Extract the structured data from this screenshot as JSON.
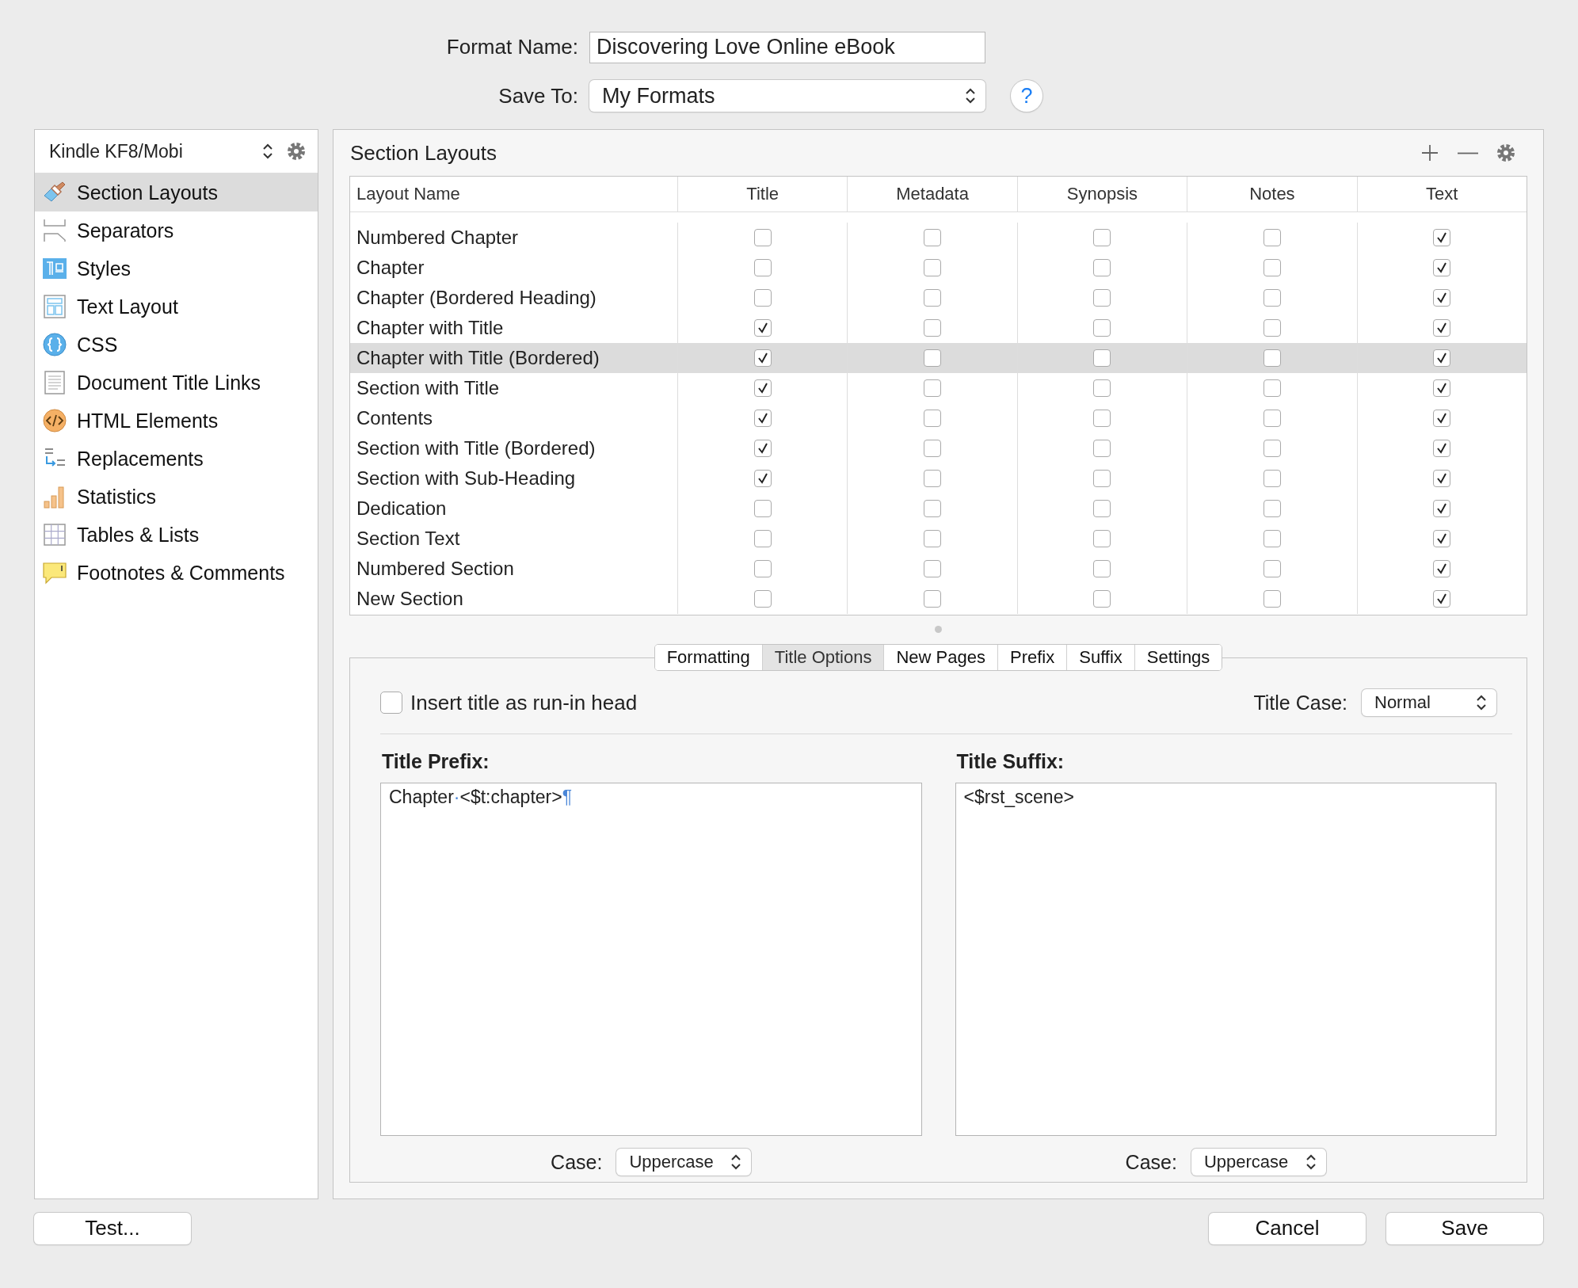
{
  "format_name": {
    "label": "Format Name:",
    "value": "Discovering Love Online eBook"
  },
  "save_to": {
    "label": "Save To:",
    "value": "My Formats"
  },
  "help_button": {
    "label": "?"
  },
  "sidebar": {
    "format_popup": "Kindle KF8/Mobi",
    "items": [
      {
        "label": "Section Layouts",
        "selected": true
      },
      {
        "label": "Separators",
        "selected": false
      },
      {
        "label": "Styles",
        "selected": false
      },
      {
        "label": "Text Layout",
        "selected": false
      },
      {
        "label": "CSS",
        "selected": false
      },
      {
        "label": "Document Title Links",
        "selected": false
      },
      {
        "label": "HTML Elements",
        "selected": false
      },
      {
        "label": "Replacements",
        "selected": false
      },
      {
        "label": "Statistics",
        "selected": false
      },
      {
        "label": "Tables & Lists",
        "selected": false
      },
      {
        "label": "Footnotes & Comments",
        "selected": false
      }
    ]
  },
  "section_layouts": {
    "title": "Section Layouts",
    "columns": [
      "Layout Name",
      "Title",
      "Metadata",
      "Synopsis",
      "Notes",
      "Text"
    ],
    "rows": [
      {
        "name": "Numbered Chapter",
        "checks": [
          false,
          false,
          false,
          false,
          true
        ],
        "selected": false
      },
      {
        "name": "Chapter",
        "checks": [
          false,
          false,
          false,
          false,
          true
        ],
        "selected": false
      },
      {
        "name": "Chapter (Bordered Heading)",
        "checks": [
          false,
          false,
          false,
          false,
          true
        ],
        "selected": false
      },
      {
        "name": "Chapter with Title",
        "checks": [
          true,
          false,
          false,
          false,
          true
        ],
        "selected": false
      },
      {
        "name": "Chapter with Title (Bordered)",
        "checks": [
          true,
          false,
          false,
          false,
          true
        ],
        "selected": true
      },
      {
        "name": "Section with Title",
        "checks": [
          true,
          false,
          false,
          false,
          true
        ],
        "selected": false
      },
      {
        "name": "Contents",
        "checks": [
          true,
          false,
          false,
          false,
          true
        ],
        "selected": false
      },
      {
        "name": "Section with Title (Bordered)",
        "checks": [
          true,
          false,
          false,
          false,
          true
        ],
        "selected": false
      },
      {
        "name": "Section with Sub-Heading",
        "checks": [
          true,
          false,
          false,
          false,
          true
        ],
        "selected": false
      },
      {
        "name": "Dedication",
        "checks": [
          false,
          false,
          false,
          false,
          true
        ],
        "selected": false
      },
      {
        "name": "Section Text",
        "checks": [
          false,
          false,
          false,
          false,
          true
        ],
        "selected": false
      },
      {
        "name": "Numbered Section",
        "checks": [
          false,
          false,
          false,
          false,
          true
        ],
        "selected": false
      },
      {
        "name": "New Section",
        "checks": [
          false,
          false,
          false,
          false,
          true
        ],
        "selected": false
      }
    ]
  },
  "tabs": [
    {
      "label": "Formatting",
      "selected": false
    },
    {
      "label": "Title Options",
      "selected": true
    },
    {
      "label": "New Pages",
      "selected": false
    },
    {
      "label": "Prefix",
      "selected": false
    },
    {
      "label": "Suffix",
      "selected": false
    },
    {
      "label": "Settings",
      "selected": false
    }
  ],
  "title_options": {
    "run_in_head": {
      "label": "Insert title as run-in head",
      "checked": false
    },
    "title_case": {
      "label": "Title Case:",
      "value": "Normal"
    },
    "prefix": {
      "label": "Title Prefix:",
      "text": [
        {
          "kind": "plain",
          "text": "Chapter"
        },
        {
          "kind": "invisible",
          "text": "·"
        },
        {
          "kind": "plain",
          "text": "<$t:chapter>"
        },
        {
          "kind": "invisible",
          "text": "¶"
        }
      ],
      "case": {
        "label": "Case:",
        "value": "Uppercase"
      }
    },
    "suffix": {
      "label": "Title Suffix:",
      "text": [
        {
          "kind": "plain",
          "text": "<$rst_scene>"
        }
      ],
      "case": {
        "label": "Case:",
        "value": "Uppercase"
      }
    }
  },
  "buttons": {
    "test": "Test...",
    "cancel": "Cancel",
    "save": "Save"
  }
}
